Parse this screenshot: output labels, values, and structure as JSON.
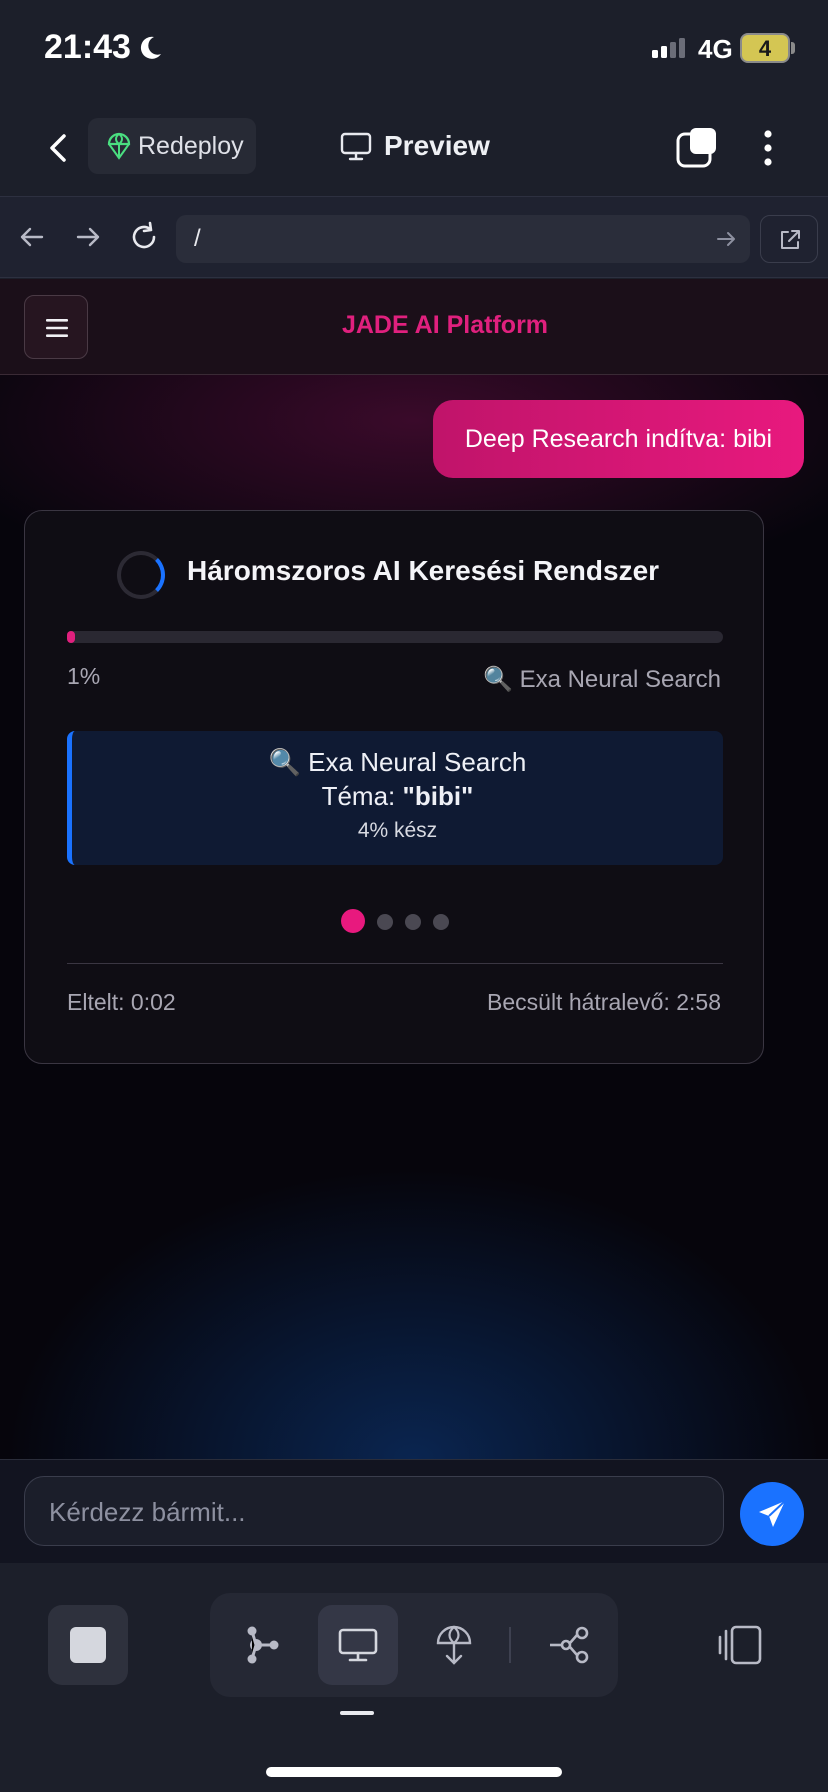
{
  "status": {
    "time": "21:43",
    "network": "4G",
    "battery": "4"
  },
  "header": {
    "redeploy_label": "Redeploy",
    "preview_label": "Preview"
  },
  "urlbar": {
    "url": "/"
  },
  "site": {
    "title": "JADE AI Platform"
  },
  "chat": {
    "user_message": "Deep Research indítva: bibi"
  },
  "research": {
    "title": "Háromszoros AI Keresési Rendszer",
    "progress_percent": 1,
    "progress_label": "1%",
    "stage": "🔍 Exa Neural Search",
    "stage_box": {
      "line1": "🔍 Exa Neural Search",
      "topic_label": "Téma: ",
      "topic_value": "\"bibi\"",
      "status": "4% kész"
    },
    "steps_total": 4,
    "steps_active": 1,
    "elapsed": "Eltelt: 0:02",
    "remaining": "Becsült hátralevő: 2:58"
  },
  "input": {
    "placeholder": "Kérdezz bármit..."
  },
  "colors": {
    "accent_pink": "#e8197e",
    "accent_blue": "#1a72ff",
    "title_pink": "#e0207e"
  }
}
